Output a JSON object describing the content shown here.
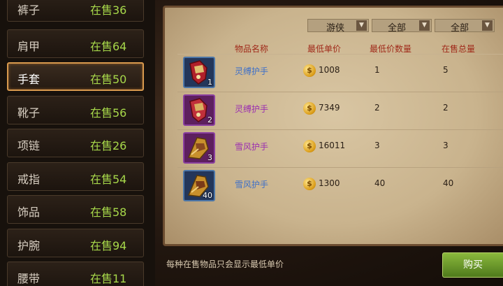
{
  "categories": [
    {
      "name": "裤子",
      "count": "在售36"
    },
    {
      "name": "肩甲",
      "count": "在售64"
    },
    {
      "name": "手套",
      "count": "在售50",
      "selected": true
    },
    {
      "name": "靴子",
      "count": "在售56"
    },
    {
      "name": "项链",
      "count": "在售26"
    },
    {
      "name": "戒指",
      "count": "在售54"
    },
    {
      "name": "饰品",
      "count": "在售58"
    },
    {
      "name": "护腕",
      "count": "在售94"
    },
    {
      "name": "腰带",
      "count": "在售11"
    }
  ],
  "filters": [
    {
      "value": "游侠"
    },
    {
      "value": "全部"
    },
    {
      "value": "全部"
    }
  ],
  "table": {
    "headers": [
      "物品名称",
      "最低单价",
      "最低价数量",
      "在售总量"
    ],
    "rows": [
      {
        "qty": "1",
        "name": "灵缚护手",
        "name_color": "blue",
        "price": "1008",
        "min_qty": "1",
        "total": "5"
      },
      {
        "qty": "2",
        "name": "灵缚护手",
        "name_color": "purple",
        "price": "7349",
        "min_qty": "2",
        "total": "2"
      },
      {
        "qty": "3",
        "name": "雪风护手",
        "name_color": "purple",
        "price": "16011",
        "min_qty": "3",
        "total": "3"
      },
      {
        "qty": "40",
        "name": "雪风护手",
        "name_color": "blue",
        "price": "1300",
        "min_qty": "40",
        "total": "40"
      }
    ]
  },
  "notice": "每种在售物品只会显示最低单价",
  "buy_label": "购买",
  "colors": {
    "accent_green": "#a7d84a",
    "selected_border": "#d99a4e",
    "header_red": "#a02a1a"
  }
}
